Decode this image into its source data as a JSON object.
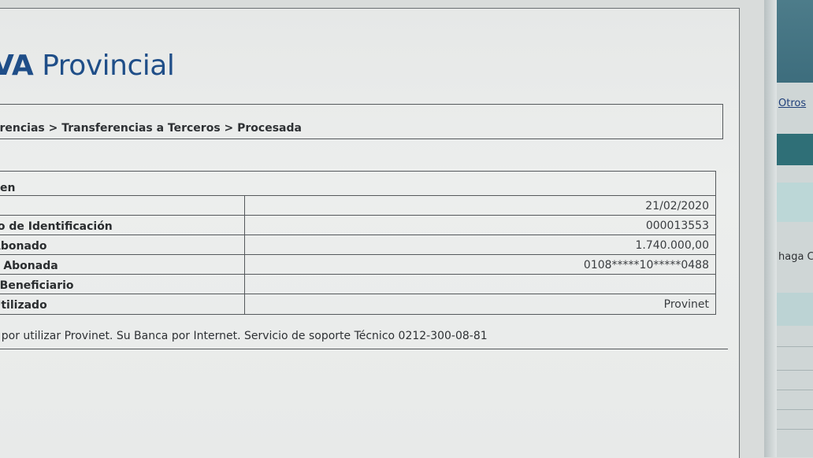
{
  "brand": {
    "logo_prefix": "VA",
    "logo_name": " Provincial"
  },
  "breadcrumb": "erencias > Transferencias a Terceros > Procesada",
  "summary": {
    "title": "nen",
    "rows": [
      {
        "label": "",
        "value": "21/02/2020"
      },
      {
        "label": "ro de Identificación",
        "value": "000013553"
      },
      {
        "label": "Abonado",
        "value": "1.740.000,00"
      },
      {
        "label": "a Abonada",
        "value": "0108*****10*****0488"
      },
      {
        "label": "l Beneficiario",
        "value": ""
      },
      {
        "label": "Utilizado",
        "value": "Provinet"
      }
    ]
  },
  "footer": "s por utilizar Provinet. Su Banca por Internet. Servicio de soporte Técnico 0212-300-08-81",
  "side_window": {
    "link": "Otros",
    "text": "haga C"
  },
  "colors": {
    "brand_blue": "#1f4e88",
    "teal": "#2f6f77"
  }
}
